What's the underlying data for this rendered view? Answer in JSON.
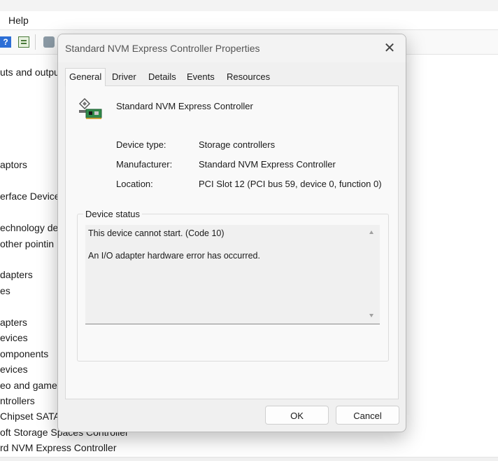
{
  "background": {
    "menu": {
      "help_label": "Help"
    },
    "toolbar_icons": [
      "help-icon",
      "properties-icon",
      "scan-hardware-icon"
    ],
    "tree_items": [
      "uts and outpu",
      "aptors",
      "erface Device",
      "echnology de",
      "other pointin",
      "dapters",
      "es",
      "apters",
      "evices",
      "omponents",
      "evices",
      "eo and game",
      "ntrollers",
      " Chipset SATA",
      "oft Storage Spaces Controller",
      "rd NVM Express Controller"
    ]
  },
  "dialog": {
    "title": "Standard NVM Express Controller Properties",
    "close_glyph": "✕",
    "tabs": [
      {
        "label": "General",
        "active": true
      },
      {
        "label": "Driver",
        "active": false
      },
      {
        "label": "Details",
        "active": false
      },
      {
        "label": "Events",
        "active": false
      },
      {
        "label": "Resources",
        "active": false
      }
    ],
    "device_name": "Standard NVM Express Controller",
    "properties": [
      {
        "label": "Device type:",
        "value": "Storage controllers"
      },
      {
        "label": "Manufacturer:",
        "value": "Standard NVM Express Controller"
      },
      {
        "label": "Location:",
        "value": "PCI Slot 12 (PCI bus 59, device 0, function 0)"
      }
    ],
    "status": {
      "legend": "Device status",
      "line1": "This device cannot start. (Code 10)",
      "line2": "An I/O adapter hardware error has occurred."
    },
    "buttons": {
      "ok": "OK",
      "cancel": "Cancel"
    }
  }
}
